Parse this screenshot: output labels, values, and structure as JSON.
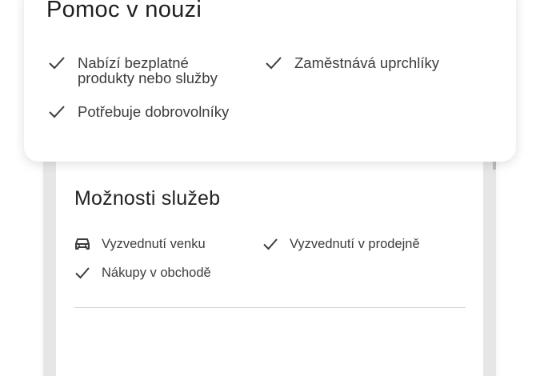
{
  "help_card": {
    "title": "Pomoc v nouzi",
    "items": [
      {
        "icon": "checkmark-icon",
        "label": "Nabízí bezplatné\nprodukty nebo služby"
      },
      {
        "icon": "checkmark-icon",
        "label": "Zaměstnává uprchlíky"
      },
      {
        "icon": "checkmark-icon",
        "label": "Potřebuje dobrovolníky"
      }
    ]
  },
  "services_card": {
    "title": "Možnosti služeb",
    "items": [
      {
        "icon": "car-icon",
        "label": "Vyzvednutí venku"
      },
      {
        "icon": "checkmark-icon",
        "label": "Vyzvednutí v prodejně"
      },
      {
        "icon": "checkmark-icon",
        "label": "Nákupy v obchodě"
      }
    ]
  }
}
